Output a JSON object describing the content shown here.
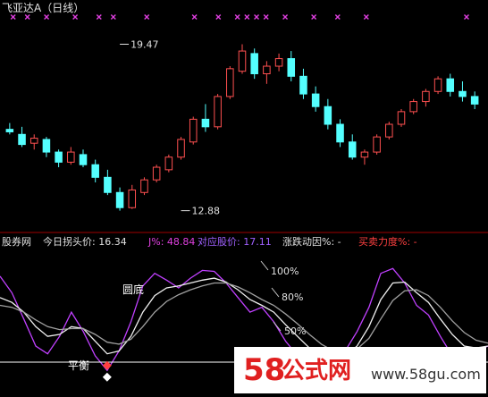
{
  "upper": {
    "title": "飞亚达A（日线）",
    "annotations": [
      {
        "text": "19.47",
        "x": 9,
        "y": 19.47
      },
      {
        "text": "12.88",
        "x": 14,
        "y": 12.88
      }
    ],
    "chart_data": {
      "type": "candlestick",
      "y_range": [
        12.3,
        20.3
      ],
      "up_color": "#ff5050",
      "down_color": "#54ffff",
      "candles": [
        {
          "o": 16.1,
          "h": 16.35,
          "l": 15.9,
          "c": 16.0
        },
        {
          "o": 15.9,
          "h": 16.2,
          "l": 15.4,
          "c": 15.5
        },
        {
          "o": 15.55,
          "h": 15.9,
          "l": 15.3,
          "c": 15.75
        },
        {
          "o": 15.7,
          "h": 15.8,
          "l": 15.0,
          "c": 15.2
        },
        {
          "o": 15.2,
          "h": 15.3,
          "l": 14.6,
          "c": 14.8
        },
        {
          "o": 14.8,
          "h": 15.4,
          "l": 14.7,
          "c": 15.2
        },
        {
          "o": 15.1,
          "h": 15.3,
          "l": 14.6,
          "c": 14.7
        },
        {
          "o": 14.7,
          "h": 14.9,
          "l": 14.0,
          "c": 14.2
        },
        {
          "o": 14.2,
          "h": 14.5,
          "l": 13.5,
          "c": 13.6
        },
        {
          "o": 13.6,
          "h": 13.8,
          "l": 12.88,
          "c": 13.0
        },
        {
          "o": 13.0,
          "h": 13.9,
          "l": 12.95,
          "c": 13.7
        },
        {
          "o": 13.6,
          "h": 14.2,
          "l": 13.5,
          "c": 14.1
        },
        {
          "o": 14.1,
          "h": 14.7,
          "l": 14.0,
          "c": 14.6
        },
        {
          "o": 14.5,
          "h": 15.1,
          "l": 14.4,
          "c": 15.0
        },
        {
          "o": 15.0,
          "h": 15.8,
          "l": 14.9,
          "c": 15.7
        },
        {
          "o": 15.6,
          "h": 16.6,
          "l": 15.5,
          "c": 16.5
        },
        {
          "o": 16.5,
          "h": 17.1,
          "l": 16.0,
          "c": 16.2
        },
        {
          "o": 16.2,
          "h": 17.5,
          "l": 16.1,
          "c": 17.4
        },
        {
          "o": 17.4,
          "h": 18.6,
          "l": 17.3,
          "c": 18.5
        },
        {
          "o": 18.4,
          "h": 19.47,
          "l": 18.3,
          "c": 19.2
        },
        {
          "o": 19.1,
          "h": 19.3,
          "l": 18.1,
          "c": 18.3
        },
        {
          "o": 18.3,
          "h": 18.8,
          "l": 17.9,
          "c": 18.6
        },
        {
          "o": 18.6,
          "h": 19.1,
          "l": 18.4,
          "c": 18.9
        },
        {
          "o": 18.9,
          "h": 19.2,
          "l": 18.0,
          "c": 18.2
        },
        {
          "o": 18.2,
          "h": 18.5,
          "l": 17.3,
          "c": 17.5
        },
        {
          "o": 17.5,
          "h": 17.8,
          "l": 16.8,
          "c": 17.0
        },
        {
          "o": 17.0,
          "h": 17.3,
          "l": 16.1,
          "c": 16.3
        },
        {
          "o": 16.3,
          "h": 16.5,
          "l": 15.4,
          "c": 15.6
        },
        {
          "o": 15.6,
          "h": 15.9,
          "l": 14.9,
          "c": 15.0
        },
        {
          "o": 15.0,
          "h": 15.3,
          "l": 14.7,
          "c": 15.2
        },
        {
          "o": 15.2,
          "h": 15.9,
          "l": 15.1,
          "c": 15.8
        },
        {
          "o": 15.8,
          "h": 16.4,
          "l": 15.7,
          "c": 16.3
        },
        {
          "o": 16.3,
          "h": 16.9,
          "l": 16.2,
          "c": 16.8
        },
        {
          "o": 16.8,
          "h": 17.3,
          "l": 16.7,
          "c": 17.2
        },
        {
          "o": 17.2,
          "h": 17.7,
          "l": 17.0,
          "c": 17.6
        },
        {
          "o": 17.6,
          "h": 18.2,
          "l": 17.5,
          "c": 18.1
        },
        {
          "o": 18.1,
          "h": 18.3,
          "l": 17.4,
          "c": 17.6
        },
        {
          "o": 17.6,
          "h": 18.0,
          "l": 17.2,
          "c": 17.4
        },
        {
          "o": 17.4,
          "h": 17.6,
          "l": 16.9,
          "c": 17.1
        }
      ],
      "top_markers": [
        {
          "type": "cross",
          "color": "#e040e0",
          "pos": 0.02
        },
        {
          "type": "cross",
          "color": "#e040e0",
          "pos": 0.05
        },
        {
          "type": "cross",
          "color": "#e040e0",
          "pos": 0.09
        },
        {
          "type": "cross",
          "color": "#e040e0",
          "pos": 0.15
        },
        {
          "type": "cross",
          "color": "#e040e0",
          "pos": 0.2
        },
        {
          "type": "cross",
          "color": "#e040e0",
          "pos": 0.23
        },
        {
          "type": "cross",
          "color": "#e040e0",
          "pos": 0.3
        },
        {
          "type": "cross",
          "color": "#e040e0",
          "pos": 0.4
        },
        {
          "type": "cross",
          "color": "#e040e0",
          "pos": 0.45
        },
        {
          "type": "cross",
          "color": "#e040e0",
          "pos": 0.49
        },
        {
          "type": "cross",
          "color": "#e040e0",
          "pos": 0.51
        },
        {
          "type": "cross",
          "color": "#e040e0",
          "pos": 0.53
        },
        {
          "type": "cross",
          "color": "#e040e0",
          "pos": 0.55
        },
        {
          "type": "cross",
          "color": "#e040e0",
          "pos": 0.59
        },
        {
          "type": "cross",
          "color": "#e040e0",
          "pos": 0.65
        },
        {
          "type": "cross",
          "color": "#e040e0",
          "pos": 0.7
        },
        {
          "type": "cross",
          "color": "#e040e0",
          "pos": 0.76
        },
        {
          "type": "cross",
          "color": "#e040e0",
          "pos": 0.97
        }
      ]
    }
  },
  "lower": {
    "header_items": [
      {
        "text": "股券网",
        "color": "#e0e0e0"
      },
      {
        "text": "今日拐头价: 16.34",
        "color": "#e0e0e0"
      },
      {
        "text": "J%: 48.84",
        "color": "#e040e0"
      },
      {
        "text": "对应股价: 17.11",
        "color": "#a060ff"
      },
      {
        "text": "涨跌动因%: -",
        "color": "#e0e0e0"
      },
      {
        "text": "买卖力度%: -",
        "color": "#ff4040"
      }
    ],
    "labels": {
      "level_100": "100%",
      "level_80": "80%",
      "level_50": "50%",
      "round_bottom": "圆底",
      "balance": "平衡"
    },
    "chart_data": {
      "type": "line",
      "y_range": [
        -0.15,
        1.15
      ],
      "series": [
        {
          "color": "#c040ff",
          "values": [
            0.92,
            0.75,
            0.48,
            0.2,
            0.12,
            0.3,
            0.55,
            0.35,
            0.1,
            -0.05,
            0.15,
            0.45,
            0.82,
            0.95,
            0.88,
            0.8,
            0.9,
            0.98,
            0.97,
            0.85,
            0.7,
            0.55,
            0.6,
            0.45,
            0.25,
            0.1,
            -0.05,
            -0.1,
            0.05,
            0.15,
            0.35,
            0.6,
            0.95,
            1.0,
            0.85,
            0.62,
            0.52,
            0.3,
            0.1,
            0.05,
            0.15,
            0.2
          ]
        },
        {
          "color": "#f0f0f0",
          "values": [
            0.7,
            0.65,
            0.55,
            0.4,
            0.3,
            0.32,
            0.4,
            0.38,
            0.25,
            0.12,
            0.15,
            0.3,
            0.55,
            0.72,
            0.8,
            0.82,
            0.85,
            0.88,
            0.9,
            0.86,
            0.78,
            0.68,
            0.62,
            0.55,
            0.42,
            0.3,
            0.18,
            0.08,
            0.06,
            0.1,
            0.2,
            0.4,
            0.68,
            0.85,
            0.86,
            0.75,
            0.65,
            0.48,
            0.32,
            0.2,
            0.18,
            0.2
          ]
        },
        {
          "color": "#a0a0a0",
          "values": [
            0.62,
            0.6,
            0.55,
            0.47,
            0.4,
            0.37,
            0.38,
            0.38,
            0.32,
            0.24,
            0.22,
            0.27,
            0.4,
            0.55,
            0.66,
            0.73,
            0.78,
            0.82,
            0.85,
            0.85,
            0.81,
            0.75,
            0.68,
            0.62,
            0.53,
            0.43,
            0.32,
            0.22,
            0.15,
            0.13,
            0.17,
            0.28,
            0.48,
            0.67,
            0.77,
            0.78,
            0.72,
            0.6,
            0.46,
            0.34,
            0.26,
            0.23
          ]
        }
      ],
      "markers": [
        {
          "type": "diamond",
          "color": "#ff4040",
          "x": 9,
          "y": 0.0
        },
        {
          "type": "diamond",
          "color": "#ffffff",
          "x": 9,
          "y": -0.12
        }
      ]
    }
  },
  "watermark": {
    "number": "58",
    "cn": "公式网",
    "url": "www.58gu.com"
  }
}
